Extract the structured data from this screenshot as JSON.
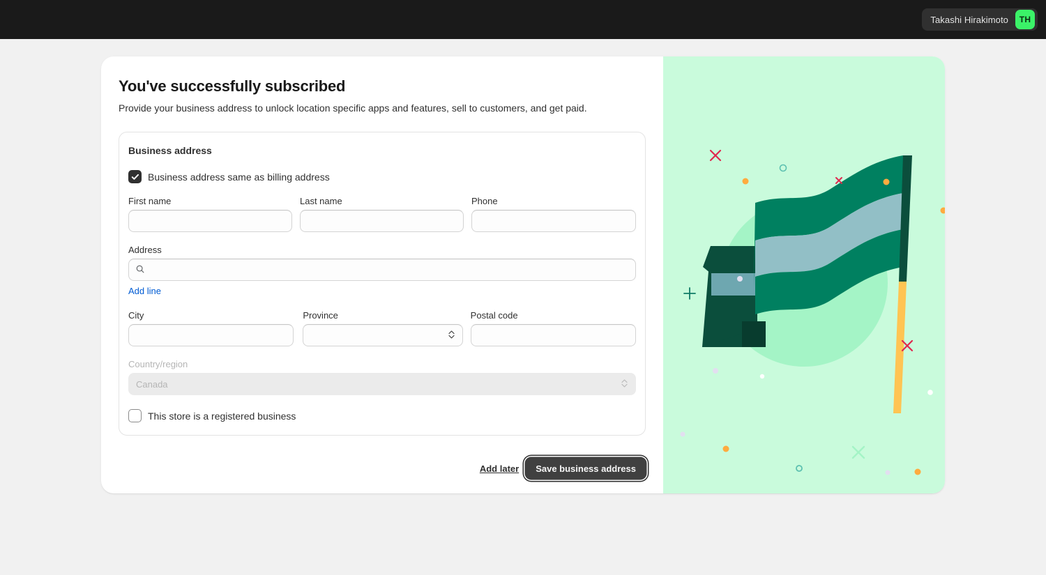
{
  "topbar": {
    "user_name": "Takashi Hirakimoto",
    "avatar_initials": "TH",
    "bg_color": "#1a1a1a",
    "avatar_color": "#3bf268"
  },
  "card": {
    "title": "You've successfully subscribed",
    "subtitle": "Provide your business address to unlock location specific apps and features, sell to customers, and get paid."
  },
  "section": {
    "title": "Business address",
    "same_as_billing": {
      "label": "Business address same as billing address",
      "checked": true
    },
    "registered_business": {
      "label": "This store is a registered business",
      "checked": false
    },
    "fields": {
      "first_name": {
        "label": "First name",
        "value": "",
        "placeholder": ""
      },
      "last_name": {
        "label": "Last name",
        "value": "",
        "placeholder": ""
      },
      "phone": {
        "label": "Phone",
        "value": "",
        "placeholder": ""
      },
      "address": {
        "label": "Address",
        "value": "",
        "placeholder": "",
        "icon": "search-icon"
      },
      "city": {
        "label": "City",
        "value": "",
        "placeholder": ""
      },
      "province": {
        "label": "Province",
        "value": "",
        "placeholder": "",
        "icon": "chevron-updown-icon"
      },
      "postal_code": {
        "label": "Postal code",
        "value": "",
        "placeholder": ""
      },
      "country": {
        "label": "Country/region",
        "value": "Canada",
        "placeholder": "",
        "disabled": true,
        "icon": "chevron-updown-icon"
      }
    },
    "add_line_label": "Add line"
  },
  "actions": {
    "secondary_label": "Add later",
    "primary_label": "Save business address",
    "primary_color": "#404040"
  },
  "illustration": {
    "name": "flag-celebration-illustration",
    "bg_color": "#c9fbdc",
    "circle_color": "#a4f4c6",
    "flag_dark_green": "#0b4e3c",
    "flag_green": "#008060",
    "flag_blue": "#92bfc6",
    "pole_dark": "#0b4e3c",
    "pole_orange": "#ffc453",
    "accent_orange": "#ffab3f",
    "accent_red": "#e0294e",
    "accent_teal": "#5cc0b0",
    "accent_white": "#ffffff",
    "accent_lavender": "#e2dff0"
  }
}
